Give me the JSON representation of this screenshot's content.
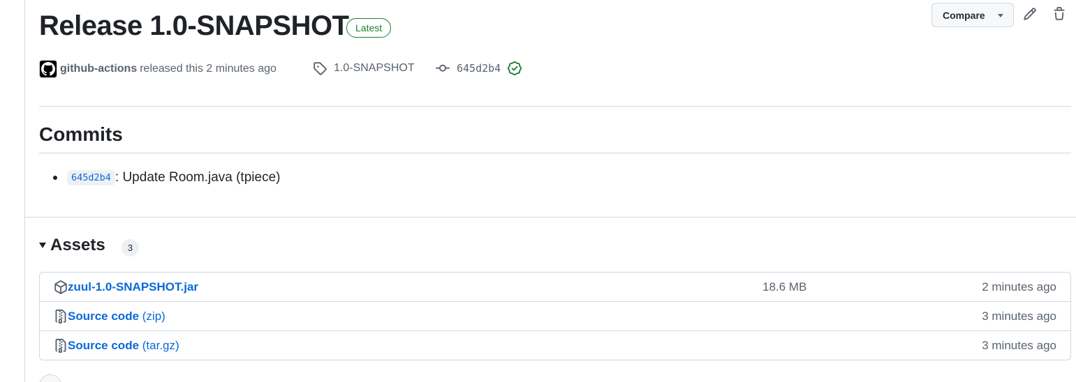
{
  "release": {
    "title": "Release 1.0-SNAPSHOT",
    "badge": "Latest"
  },
  "toolbar": {
    "compare_label": "Compare"
  },
  "meta": {
    "author": "github-actions",
    "released_text": "released this 2 minutes ago",
    "tag": "1.0-SNAPSHOT",
    "commit_sha": "645d2b4"
  },
  "commits": {
    "heading": "Commits",
    "items": [
      {
        "sha": "645d2b4",
        "message": ": Update Room.java (tpiece)"
      }
    ]
  },
  "assets": {
    "heading": "Assets",
    "count": "3",
    "items": [
      {
        "name": "zuul-1.0-SNAPSHOT.jar",
        "suffix": "",
        "size": "18.6 MB",
        "time": "2 minutes ago",
        "icon": "package-icon"
      },
      {
        "name": "Source code",
        "suffix": " (zip)",
        "size": "",
        "time": "3 minutes ago",
        "icon": "file-zip-icon"
      },
      {
        "name": "Source code",
        "suffix": " (tar.gz)",
        "size": "",
        "time": "3 minutes ago",
        "icon": "file-zip-icon"
      }
    ]
  },
  "colors": {
    "accent": "#0969da",
    "success": "#1a7f37",
    "muted": "#59636e",
    "border": "#d1d9e0"
  }
}
